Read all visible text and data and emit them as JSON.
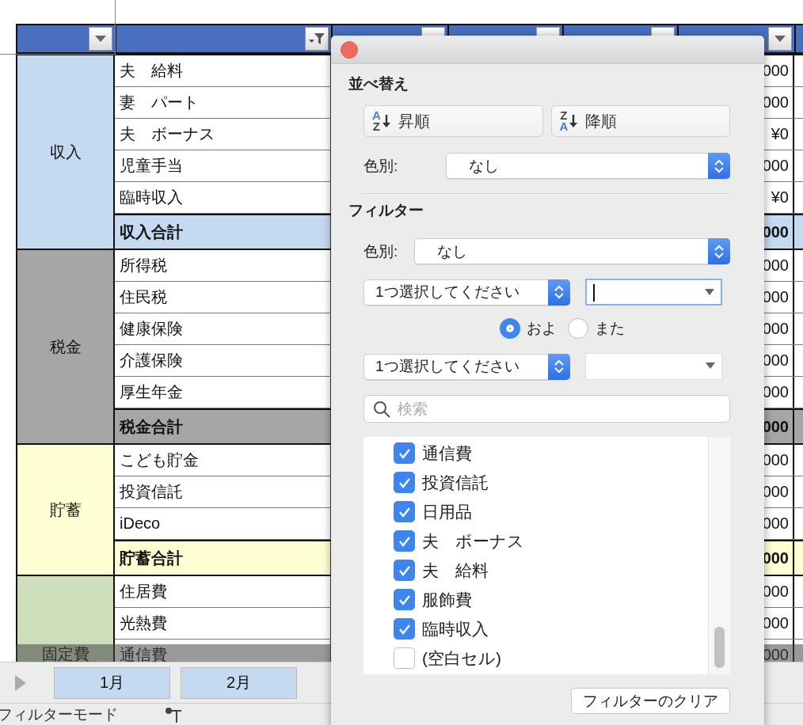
{
  "header": {
    "columns": [
      {
        "kind": "dropdown"
      },
      {
        "kind": "filter"
      },
      {
        "kind": "dropdown"
      },
      {
        "kind": "dropdown"
      },
      {
        "kind": "dropdown"
      },
      {
        "kind": "dropdown"
      }
    ]
  },
  "groups": [
    {
      "label": "収入",
      "color": "#c5d9f1",
      "rows": [
        {
          "item": "夫　給料",
          "value": "000"
        },
        {
          "item": "妻　パート",
          "value": "000"
        },
        {
          "item": "夫　ボーナス",
          "value": "¥0"
        },
        {
          "item": "児童手当",
          "value": "000"
        },
        {
          "item": "臨時収入",
          "value": "¥0"
        }
      ],
      "total": {
        "item": "収入合計",
        "value": "000"
      }
    },
    {
      "label": "税金",
      "color": "#a6a6a6",
      "rows": [
        {
          "item": "所得税",
          "value": "000"
        },
        {
          "item": "住民税",
          "value": "000"
        },
        {
          "item": "健康保険",
          "value": "000"
        },
        {
          "item": "介護保険",
          "value": "000"
        },
        {
          "item": "厚生年金",
          "value": "000"
        }
      ],
      "total": {
        "item": "税金合計",
        "value": "000"
      }
    },
    {
      "label": "貯蓄",
      "color": "#ffffd3",
      "rows": [
        {
          "item": "こども貯金",
          "value": "000"
        },
        {
          "item": "投資信託",
          "value": "000"
        },
        {
          "item": "iDeco",
          "value": "000"
        }
      ],
      "total": {
        "item": "貯蓄合計",
        "value": "000"
      }
    },
    {
      "label": "固定費",
      "color": "#cde0bb",
      "rows": [
        {
          "item": "住居費",
          "value": "000"
        },
        {
          "item": "光熱費",
          "value": "000"
        },
        {
          "item": "通信費",
          "value": "000"
        }
      ]
    }
  ],
  "sheet_tabs": [
    {
      "label": "1月"
    },
    {
      "label": "2月"
    }
  ],
  "status_bar": {
    "mode": "フィルターモード"
  },
  "popup": {
    "sort": {
      "title": "並べ替え",
      "buttons": [
        {
          "kind": "ascending",
          "letters": [
            "A",
            "Z"
          ],
          "label": "昇順"
        },
        {
          "kind": "descending",
          "letters": [
            "Z",
            "A"
          ],
          "label": "降順"
        }
      ],
      "color_label": "色別:",
      "color_value": "なし"
    },
    "filter": {
      "title": "フィルター",
      "color_label": "色別:",
      "color_value": "なし",
      "conditions": [
        {
          "select": "1つ選択してください",
          "focused": true
        },
        {
          "select": "1つ選択してください",
          "focused": false
        }
      ],
      "logic": [
        {
          "label": "およ",
          "selected": true
        },
        {
          "label": "また",
          "selected": false
        }
      ],
      "search_placeholder": "検索",
      "values": [
        {
          "label": "通信費",
          "checked": true
        },
        {
          "label": "投資信託",
          "checked": true
        },
        {
          "label": "日用品",
          "checked": true
        },
        {
          "label": "夫　ボーナス",
          "checked": true
        },
        {
          "label": "夫　給料",
          "checked": true
        },
        {
          "label": "服飾費",
          "checked": true
        },
        {
          "label": "臨時収入",
          "checked": true
        },
        {
          "label": "(空白セル)",
          "checked": false
        }
      ],
      "clear": "フィルターのクリア"
    }
  }
}
